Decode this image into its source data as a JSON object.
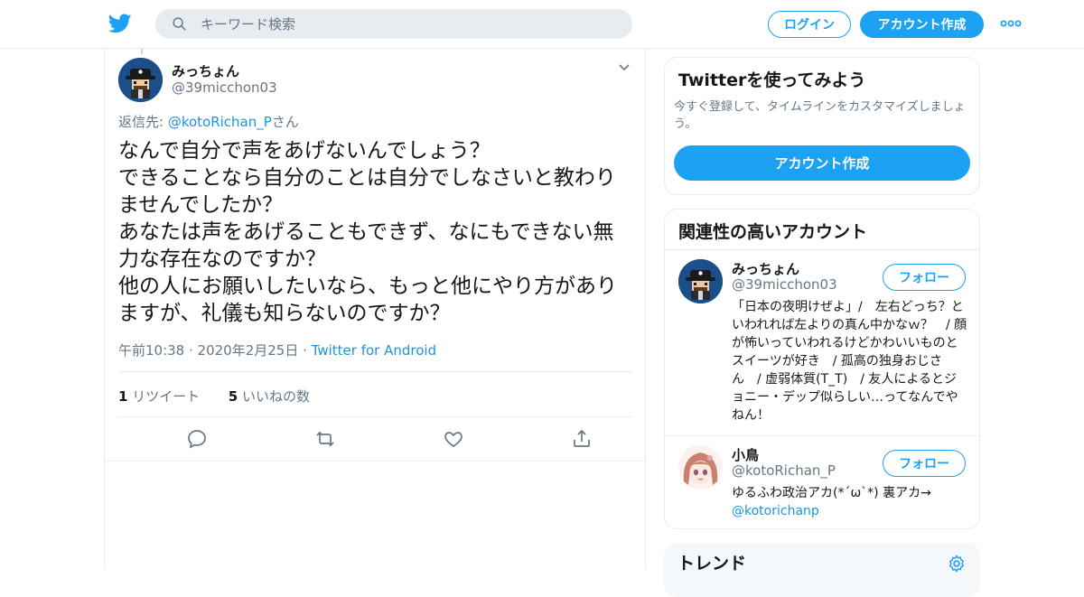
{
  "header": {
    "search_placeholder": "キーワード検索",
    "login_label": "ログイン",
    "signup_label": "アカウント作成"
  },
  "tweet": {
    "author_name": "みっちょん",
    "author_handle": "@39micchon03",
    "reply_prefix": "返信先: ",
    "reply_link": "@kotoRichan_P",
    "reply_suffix": "さん",
    "text": "なんで自分で声をあげないんでしょう？\nできることなら自分のことは自分でしなさいと教わりませんでしたか？\nあなたは声をあげることもできず、なにもできない無力な存在なのですか？\n他の人にお願いしたいなら、もっと他にやり方がありますが、礼儀も知らないのですか？",
    "timestamp": "午前10:38 · 2020年2月25日 · ",
    "source": "Twitter for Android",
    "retweet_count": "1",
    "retweet_label": " リツイート",
    "like_count": "5",
    "like_label": " いいねの数"
  },
  "sidebar": {
    "try_card": {
      "title": "Twitterを使ってみよう",
      "description": "今すぐ登録して、タイムラインをカスタマイズしましょう。",
      "button": "アカウント作成"
    },
    "related": {
      "title": "関連性の高いアカウント",
      "follow_label": "フォロー",
      "accounts": [
        {
          "name": "みっちょん",
          "handle": "@39micchon03",
          "bio": "「日本の夜明けぜよ」/　左右どっち？といわれれば左よりの真ん中かなｗ？　/ 顔が怖いっていわれるけどかわいいものとスイーツが好き　/ 孤高の独身おじさん　/ 虚弱体質(T_T)　/ 友人によるとジョニー・デップ似らしい…ってなんでやねん！"
        },
        {
          "name": "小鳥",
          "handle": "@kotoRichan_P",
          "bio": "ゆるふわ政治アカ(*´ω`*) 裏アカ→",
          "bio_link": "@kotorichanp"
        }
      ]
    },
    "trends": {
      "title": "トレンド"
    }
  },
  "colors": {
    "accent": "#1da1f2",
    "link": "#1b95e0",
    "secondary_text": "#657786",
    "border": "#e6ecf0"
  },
  "icons": [
    "twitter-logo-icon",
    "search-icon",
    "more-icon",
    "chevron-down-icon",
    "reply-icon",
    "retweet-icon",
    "like-icon",
    "share-icon",
    "gear-icon"
  ]
}
